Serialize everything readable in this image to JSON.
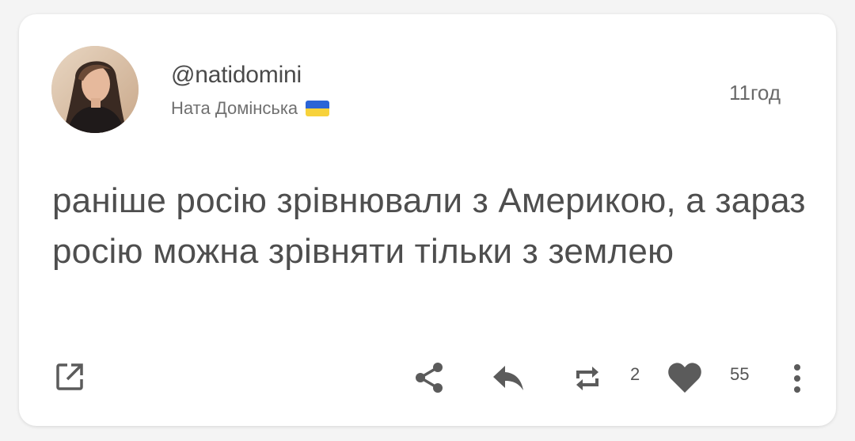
{
  "post": {
    "handle": "@natidomini",
    "display_name": "Ната Домінська",
    "flag_icon": "ukraine-flag-icon",
    "timestamp": "11год",
    "text": "раніше росію зрівнювали з Америкою, а зараз росію можна зрівняти тільки з землею"
  },
  "actions": {
    "open_icon": "open-external-icon",
    "share_icon": "share-icon",
    "reply_icon": "reply-icon",
    "repost_icon": "repost-icon",
    "repost_count": "2",
    "like_icon": "heart-icon",
    "like_count": "55",
    "more_icon": "more-vertical-icon"
  },
  "colors": {
    "icon": "#5b5b5b",
    "flag_blue": "#2a64d6",
    "flag_yellow": "#f7d23b"
  }
}
